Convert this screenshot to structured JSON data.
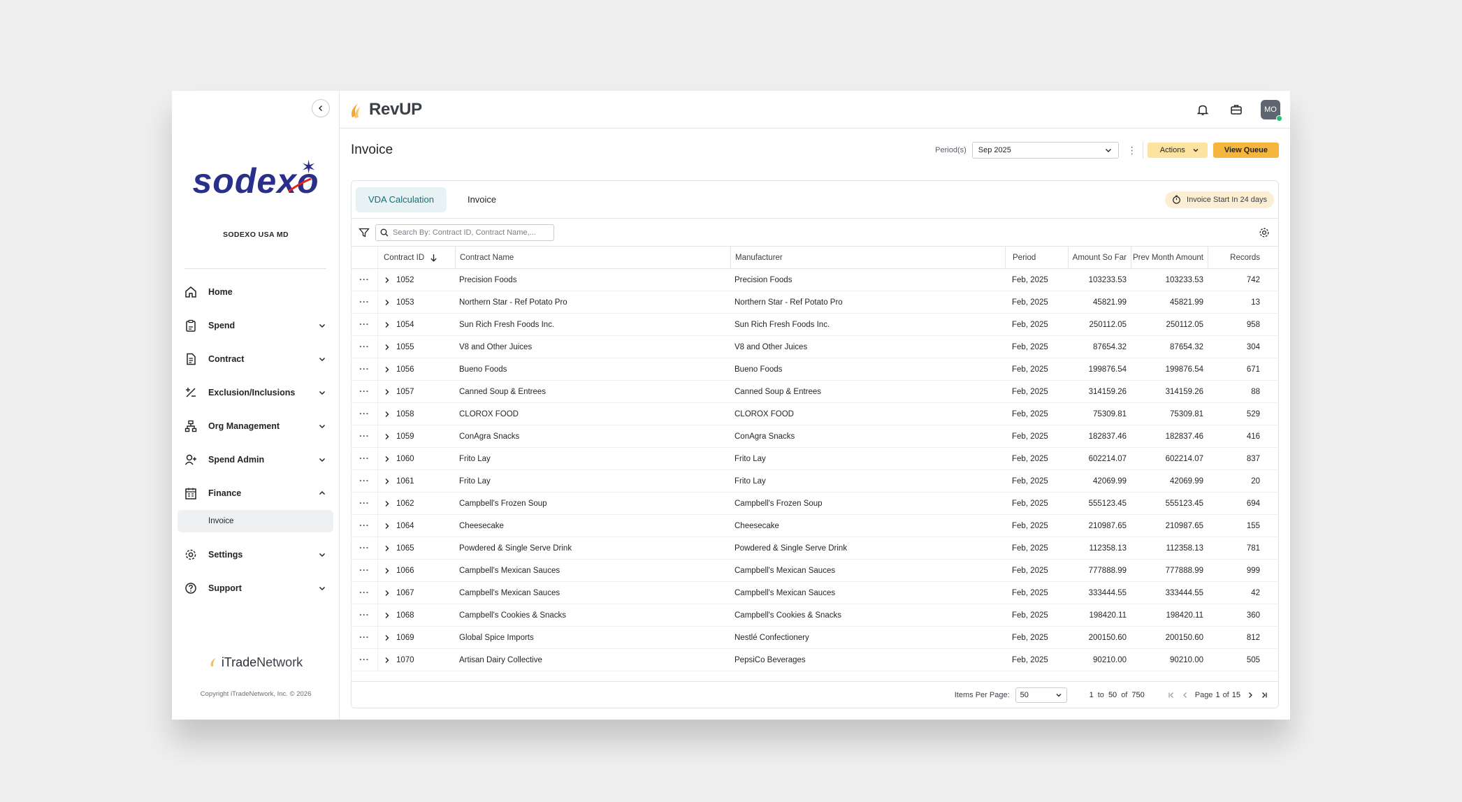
{
  "sidebar": {
    "org_name": "SODEXO USA MD",
    "logo_text": "sodexo",
    "items": [
      {
        "label": "Home",
        "icon": "home-icon",
        "has_chevron": false
      },
      {
        "label": "Spend",
        "icon": "clipboard-icon",
        "has_chevron": true
      },
      {
        "label": "Contract",
        "icon": "document-icon",
        "has_chevron": true
      },
      {
        "label": "Exclusion/Inclusions",
        "icon": "plus-minus-icon",
        "has_chevron": true
      },
      {
        "label": "Org Management",
        "icon": "org-chart-icon",
        "has_chevron": true
      },
      {
        "label": "Spend Admin",
        "icon": "user-plus-icon",
        "has_chevron": true
      },
      {
        "label": "Finance",
        "icon": "finance-icon",
        "has_chevron": true,
        "expanded": true
      },
      {
        "label": "Settings",
        "icon": "gear-icon",
        "has_chevron": true
      },
      {
        "label": "Support",
        "icon": "help-icon",
        "has_chevron": true
      }
    ],
    "finance_sub": "Invoice",
    "footer_brand_a": "iTrade",
    "footer_brand_b": "Network",
    "copyright": "Copyright iTradeNetwork, Inc. © 2026"
  },
  "topbar": {
    "brand": "RevUP",
    "avatar_initials": "MO"
  },
  "header": {
    "title": "Invoice",
    "period_label": "Period(s)",
    "period_value": "Sep 2025",
    "actions_label": "Actions",
    "view_queue_label": "View Queue"
  },
  "tabs": [
    {
      "label": "VDA Calculation",
      "active": true
    },
    {
      "label": "Invoice",
      "active": false
    }
  ],
  "badge_text": "Invoice Start In 24 days",
  "search": {
    "placeholder": "Search By: Contract ID, Contract Name,..."
  },
  "table": {
    "columns": [
      "Contract ID",
      "Contract Name",
      "Manufacturer",
      "Period",
      "Amount So Far",
      "Prev Month Amount",
      "Records"
    ],
    "rows": [
      [
        "1052",
        "Precision Foods",
        "Precision Foods",
        "Feb, 2025",
        "103233.53",
        "103233.53",
        "742"
      ],
      [
        "1053",
        "Northern Star - Ref Potato Pro",
        "Northern Star - Ref Potato Pro",
        "Feb, 2025",
        "45821.99",
        "45821.99",
        "13"
      ],
      [
        "1054",
        "Sun Rich Fresh Foods Inc.",
        "Sun Rich Fresh Foods Inc.",
        "Feb, 2025",
        "250112.05",
        "250112.05",
        "958"
      ],
      [
        "1055",
        "V8 and Other Juices",
        "V8 and Other Juices",
        "Feb, 2025",
        "87654.32",
        "87654.32",
        "304"
      ],
      [
        "1056",
        "Bueno Foods",
        "Bueno Foods",
        "Feb, 2025",
        "199876.54",
        "199876.54",
        "671"
      ],
      [
        "1057",
        "Canned Soup & Entrees",
        "Canned Soup & Entrees",
        "Feb, 2025",
        "314159.26",
        "314159.26",
        "88"
      ],
      [
        "1058",
        "CLOROX FOOD",
        "CLOROX FOOD",
        "Feb, 2025",
        "75309.81",
        "75309.81",
        "529"
      ],
      [
        "1059",
        "ConAgra Snacks",
        "ConAgra Snacks",
        "Feb, 2025",
        "182837.46",
        "182837.46",
        "416"
      ],
      [
        "1060",
        "Frito Lay",
        "Frito Lay",
        "Feb, 2025",
        "602214.07",
        "602214.07",
        "837"
      ],
      [
        "1061",
        "Frito Lay",
        "Frito Lay",
        "Feb, 2025",
        "42069.99",
        "42069.99",
        "20"
      ],
      [
        "1062",
        "Campbell's Frozen Soup",
        "Campbell's Frozen Soup",
        "Feb, 2025",
        "555123.45",
        "555123.45",
        "694"
      ],
      [
        "1064",
        "Cheesecake",
        "Cheesecake",
        "Feb, 2025",
        "210987.65",
        "210987.65",
        "155"
      ],
      [
        "1065",
        "Powdered & Single Serve Drink",
        "Powdered & Single Serve Drink",
        "Feb, 2025",
        "112358.13",
        "112358.13",
        "781"
      ],
      [
        "1066",
        "Campbell's Mexican Sauces",
        "Campbell's Mexican Sauces",
        "Feb, 2025",
        "777888.99",
        "777888.99",
        "999"
      ],
      [
        "1067",
        "Campbell's Mexican Sauces",
        "Campbell's Mexican Sauces",
        "Feb, 2025",
        "333444.55",
        "333444.55",
        "42"
      ],
      [
        "1068",
        "Campbell's Cookies & Snacks",
        "Campbell's Cookies & Snacks",
        "Feb, 2025",
        "198420.11",
        "198420.11",
        "360"
      ],
      [
        "1069",
        "Global Spice Imports",
        "Nestlé Confectionery",
        "Feb, 2025",
        "200150.60",
        "200150.60",
        "812"
      ],
      [
        "1070",
        "Artisan Dairy Collective",
        "PepsiCo Beverages",
        "Feb, 2025",
        "90210.00",
        "90210.00",
        "505"
      ]
    ]
  },
  "footer": {
    "items_per_page_label": "Items Per Page:",
    "items_per_page": "50",
    "range_from": "1",
    "range_to_word": "to",
    "range_to": "50",
    "of_word": "of",
    "total": "750",
    "page_word": "Page",
    "page": "1",
    "page_of_word": "of",
    "page_total": "15"
  },
  "colors": {
    "accent_teal": "#136f78",
    "tab_bg": "#e6f2f3",
    "btn_actions": "#fde3a2",
    "btn_queue": "#f5b63d",
    "badge_bg": "#fbeed2",
    "brand_navy": "#2a2f8a"
  }
}
